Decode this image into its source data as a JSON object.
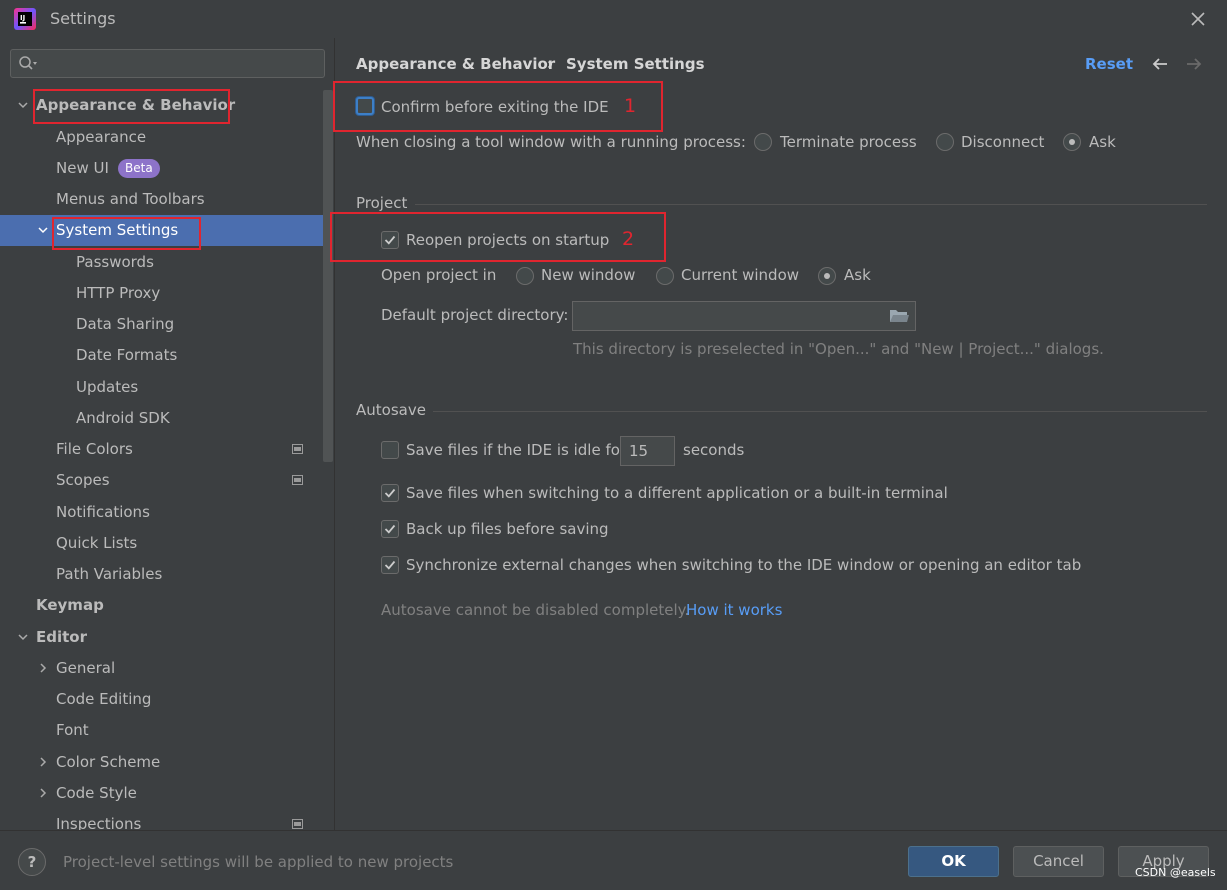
{
  "window": {
    "title": "Settings",
    "close_icon": "close-icon"
  },
  "sidebar": {
    "search_placeholder": "",
    "items": [
      {
        "label": "Appearance & Behavior",
        "chevron": "expanded"
      },
      {
        "label": "Appearance"
      },
      {
        "label": "New UI",
        "badge": "Beta"
      },
      {
        "label": "Menus and Toolbars"
      },
      {
        "label": "System Settings",
        "chevron": "expanded",
        "selected": true
      },
      {
        "label": "Passwords"
      },
      {
        "label": "HTTP Proxy"
      },
      {
        "label": "Data Sharing"
      },
      {
        "label": "Date Formats"
      },
      {
        "label": "Updates"
      },
      {
        "label": "Android SDK"
      },
      {
        "label": "File Colors",
        "project_icon": true
      },
      {
        "label": "Scopes",
        "project_icon": true
      },
      {
        "label": "Notifications"
      },
      {
        "label": "Quick Lists"
      },
      {
        "label": "Path Variables"
      },
      {
        "label": "Keymap"
      },
      {
        "label": "Editor",
        "chevron": "expanded"
      },
      {
        "label": "General",
        "chevron": "collapsed"
      },
      {
        "label": "Code Editing"
      },
      {
        "label": "Font"
      },
      {
        "label": "Color Scheme",
        "chevron": "collapsed"
      },
      {
        "label": "Code Style",
        "chevron": "collapsed"
      },
      {
        "label": "Inspections",
        "project_icon": true
      }
    ]
  },
  "breadcrumb": {
    "parent": "Appearance & Behavior",
    "separator": "›",
    "current": "System Settings"
  },
  "header_actions": {
    "reset": "Reset"
  },
  "general": {
    "confirm_exit": {
      "label": "Confirm before exiting the IDE",
      "checked": false
    },
    "closing_tool_window": {
      "label": "When closing a tool window with a running process:",
      "options": [
        "Terminate process",
        "Disconnect",
        "Ask"
      ],
      "selected": "Ask"
    }
  },
  "project": {
    "title": "Project",
    "reopen": {
      "label": "Reopen projects on startup",
      "checked": true
    },
    "open_in": {
      "label": "Open project in",
      "options": [
        "New window",
        "Current window",
        "Ask"
      ],
      "selected": "Ask"
    },
    "default_dir": {
      "label": "Default project directory:",
      "value": "",
      "hint": "This directory is preselected in \"Open...\" and \"New | Project...\" dialogs."
    }
  },
  "autosave": {
    "title": "Autosave",
    "idle": {
      "label": "Save files if the IDE is idle for",
      "value": "15",
      "unit": "seconds",
      "checked": false
    },
    "switch_app": {
      "label": "Save files when switching to a different application or a built-in terminal",
      "checked": true
    },
    "backup": {
      "label": "Back up files before saving",
      "checked": true
    },
    "sync": {
      "label": "Synchronize external changes when switching to the IDE window or opening an editor tab",
      "checked": true
    },
    "note": "Autosave cannot be disabled completely.",
    "note_link": "How it works"
  },
  "annotations": {
    "one": "1",
    "two": "2"
  },
  "footer": {
    "help": "?",
    "message": "Project-level settings will be applied to new projects",
    "ok": "OK",
    "cancel": "Cancel",
    "apply": "Apply"
  },
  "watermark": "CSDN @easels",
  "colors": {
    "background": "#3c3f41",
    "selection": "#4b6eaf",
    "accent_link": "#589df6",
    "annotation_red": "#e0252f",
    "beta_badge": "#8d73c9",
    "primary_button": "#365880"
  }
}
